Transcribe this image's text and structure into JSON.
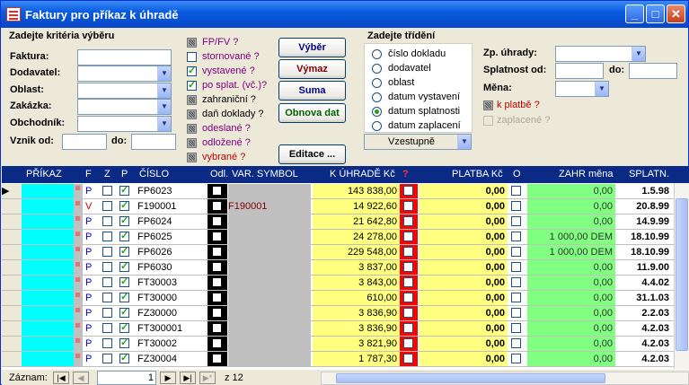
{
  "window": {
    "title": "Faktury pro příkaz k úhradě"
  },
  "criteria": {
    "heading": "Zadejte kritéria výběru",
    "faktura": "Faktura:",
    "dodavatel": "Dodavatel:",
    "oblast": "Oblast:",
    "zakazka": "Zakázka:",
    "obchodnik": "Obchodník:",
    "vznik_od": "Vznik od:",
    "do": "do:"
  },
  "filters": [
    {
      "label": "FP/FV ?",
      "state": "grey",
      "color": "#800080"
    },
    {
      "label": "stornované ?",
      "state": "off",
      "color": "#800080"
    },
    {
      "label": "vystavené ?",
      "state": "on",
      "color": "#800080"
    },
    {
      "label": "po splat. (vč.)?",
      "state": "on",
      "color": "#800080"
    },
    {
      "label": "zahraniční ?",
      "state": "grey",
      "color": "#000000"
    },
    {
      "label": "daň doklady ?",
      "state": "grey",
      "color": "#000000"
    },
    {
      "label": "odeslané ?",
      "state": "grey",
      "color": "#800080"
    },
    {
      "label": "odložené ?",
      "state": "grey",
      "color": "#800080"
    },
    {
      "label": "vybrané ?",
      "state": "grey",
      "color": "#c00000"
    }
  ],
  "buttons": {
    "vyber": "Výběr",
    "vymaz": "Výmaz",
    "suma": "Suma",
    "obnova": "Obnova dat",
    "editace": "Editace ..."
  },
  "sorting": {
    "heading": "Zadejte třídění",
    "options": [
      "číslo dokladu",
      "dodavatel",
      "oblast",
      "datum vystavení",
      "datum splatnosti",
      "datum zaplacení"
    ],
    "selected": 4,
    "direction": "Vzestupně"
  },
  "payment": {
    "zp_uhrady": "Zp. úhrady:",
    "splatnost_od": "Splatnost od:",
    "do": "do:",
    "mena": "Měna:",
    "k_platbe": "k platbě ?",
    "zaplacene": "zaplacené ?"
  },
  "grid": {
    "headers": {
      "prikaz": "PŘÍKAZ",
      "f": "F",
      "z": "Z",
      "p": "P",
      "cislo": "ČÍSLO",
      "odl": "Odl.",
      "varsym": "VAR. SYMBOL",
      "kuhrade": "K ÚHRADĚ Kč",
      "q": "?",
      "platba": "PLATBA Kč",
      "o": "O",
      "zahr": "ZAHR měna",
      "splatn": "SPLATN."
    },
    "rows": [
      {
        "f": "P",
        "cislo": "FP6023",
        "varsym": "",
        "kuhrade": "143 838,00",
        "platba": "0,00",
        "zahr": "0,00",
        "splatn": "1.5.98",
        "p": true,
        "current": true
      },
      {
        "f": "V",
        "cislo": "F190001",
        "varsym": "F190001",
        "kuhrade": "14 922,60",
        "platba": "0,00",
        "zahr": "0,00",
        "splatn": "20.8.99",
        "p": true,
        "current": false
      },
      {
        "f": "P",
        "cislo": "FP6024",
        "varsym": "",
        "kuhrade": "21 642,80",
        "platba": "0,00",
        "zahr": "0,00",
        "splatn": "14.9.99",
        "p": true,
        "current": false
      },
      {
        "f": "P",
        "cislo": "FP6025",
        "varsym": "",
        "kuhrade": "24 278,00",
        "platba": "0,00",
        "zahr": "1 000,00 DEM",
        "splatn": "18.10.99",
        "p": true,
        "current": false
      },
      {
        "f": "P",
        "cislo": "FP6026",
        "varsym": "",
        "kuhrade": "229 548,00",
        "platba": "0,00",
        "zahr": "1 000,00 DEM",
        "splatn": "18.10.99",
        "p": true,
        "current": false
      },
      {
        "f": "P",
        "cislo": "FP6030",
        "varsym": "",
        "kuhrade": "3 837,00",
        "platba": "0,00",
        "zahr": "0,00",
        "splatn": "11.9.00",
        "p": true,
        "current": false
      },
      {
        "f": "P",
        "cislo": "FT30003",
        "varsym": "",
        "kuhrade": "3 843,00",
        "platba": "0,00",
        "zahr": "0,00",
        "splatn": "4.4.02",
        "p": true,
        "current": false
      },
      {
        "f": "P",
        "cislo": "FT30000",
        "varsym": "",
        "kuhrade": "610,00",
        "platba": "0,00",
        "zahr": "0,00",
        "splatn": "31.1.03",
        "p": true,
        "current": false
      },
      {
        "f": "P",
        "cislo": "FZ30000",
        "varsym": "",
        "kuhrade": "3 836,90",
        "platba": "0,00",
        "zahr": "0,00",
        "splatn": "2.2.03",
        "p": true,
        "current": false
      },
      {
        "f": "P",
        "cislo": "FT300001",
        "varsym": "",
        "kuhrade": "3 836,90",
        "platba": "0,00",
        "zahr": "0,00",
        "splatn": "4.2.03",
        "p": true,
        "current": false
      },
      {
        "f": "P",
        "cislo": "FT30002",
        "varsym": "",
        "kuhrade": "3 821,90",
        "platba": "0,00",
        "zahr": "0,00",
        "splatn": "4.2.03",
        "p": true,
        "current": false
      },
      {
        "f": "P",
        "cislo": "FZ30004",
        "varsym": "",
        "kuhrade": "1 787,30",
        "platba": "0,00",
        "zahr": "0,00",
        "splatn": "4.2.03",
        "p": true,
        "current": false
      }
    ]
  },
  "status": {
    "zaznam": "Záznam:",
    "current": "1",
    "of": "z  12"
  },
  "colors": {
    "cyan": "#00ffff",
    "yellow": "#ffff80",
    "green": "#80ff80",
    "header": "#0b2a86",
    "red": "#ff0000"
  }
}
